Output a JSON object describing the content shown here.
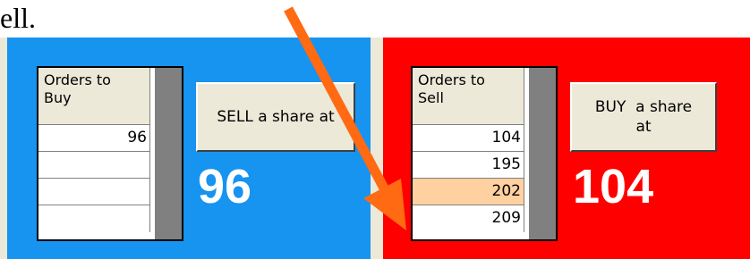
{
  "doc_fragment": "ell.",
  "buy_panel": {
    "header": "Orders to\nBuy",
    "orders": [
      "96",
      "",
      "",
      ""
    ],
    "button_label": "SELL a share at",
    "price": "96",
    "color": "#1793f0"
  },
  "sell_panel": {
    "header": "Orders to\nSell",
    "orders": [
      "104",
      "195",
      "202",
      "209"
    ],
    "highlighted_row": 2,
    "highlight_color": "#ffd0a0",
    "button_label": "BUY  a share\nat",
    "price": "104",
    "color": "#ff0000"
  },
  "annotation": {
    "arrow_icon": "orange-arrow-icon",
    "arrow_color": "#ff6a13"
  }
}
